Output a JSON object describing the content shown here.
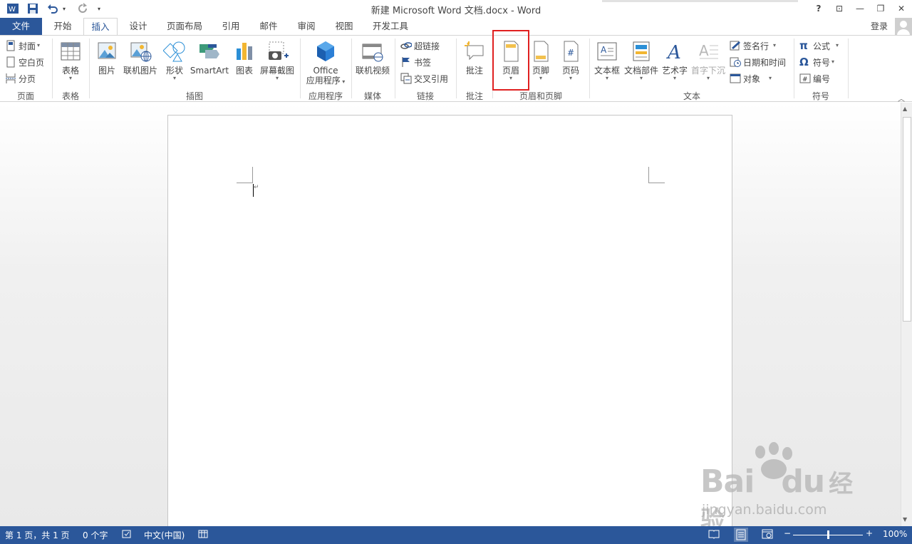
{
  "window": {
    "title": "新建 Microsoft Word 文档.docx - Word",
    "help": "?",
    "restore_label": "⊡",
    "minimize": "—",
    "maximize": "❐",
    "close": "✕",
    "undo_caret": "▾",
    "qa_more": "▾"
  },
  "tabs": [
    "文件",
    "开始",
    "插入",
    "设计",
    "页面布局",
    "引用",
    "邮件",
    "审阅",
    "视图",
    "开发工具"
  ],
  "active_tab": "插入",
  "signin": "登录",
  "ribbon": {
    "pages": {
      "items": [
        "封面",
        "空白页",
        "分页"
      ],
      "label": "页面"
    },
    "tables": {
      "button": "表格",
      "label": "表格"
    },
    "illustrations": {
      "buttons": [
        "图片",
        "联机图片",
        "形状",
        "SmartArt",
        "图表",
        "屏幕截图"
      ],
      "label": "插图"
    },
    "apps": {
      "button_line1": "Office",
      "button_line2": "应用程序",
      "label": "应用程序"
    },
    "media": {
      "button": "联机视频",
      "label": "媒体"
    },
    "links": {
      "items": [
        "超链接",
        "书签",
        "交叉引用"
      ],
      "label": "链接"
    },
    "comments": {
      "button": "批注",
      "label": "批注"
    },
    "header_footer": {
      "buttons": [
        "页眉",
        "页脚",
        "页码"
      ],
      "label": "页眉和页脚"
    },
    "text": {
      "buttons": [
        "文本框",
        "文档部件",
        "艺术字",
        "首字下沉"
      ],
      "items": [
        "签名行",
        "日期和时间",
        "对象"
      ],
      "label": "文本"
    },
    "symbols": {
      "items": [
        "公式",
        "符号",
        "编号"
      ],
      "label": "符号"
    }
  },
  "document": {
    "paragraph_mark": "↵"
  },
  "watermark": {
    "line1": "Bai",
    "line2": "du",
    "line3": "经验",
    "url": "jingyan.baidu.com"
  },
  "status": {
    "page": "第 1 页，共 1 页",
    "words": "0 个字",
    "language": "中文(中国)",
    "zoom": "100%",
    "zoom_level": 1.0
  },
  "colors": {
    "accent": "#2b579a",
    "highlight": "#e02020"
  }
}
